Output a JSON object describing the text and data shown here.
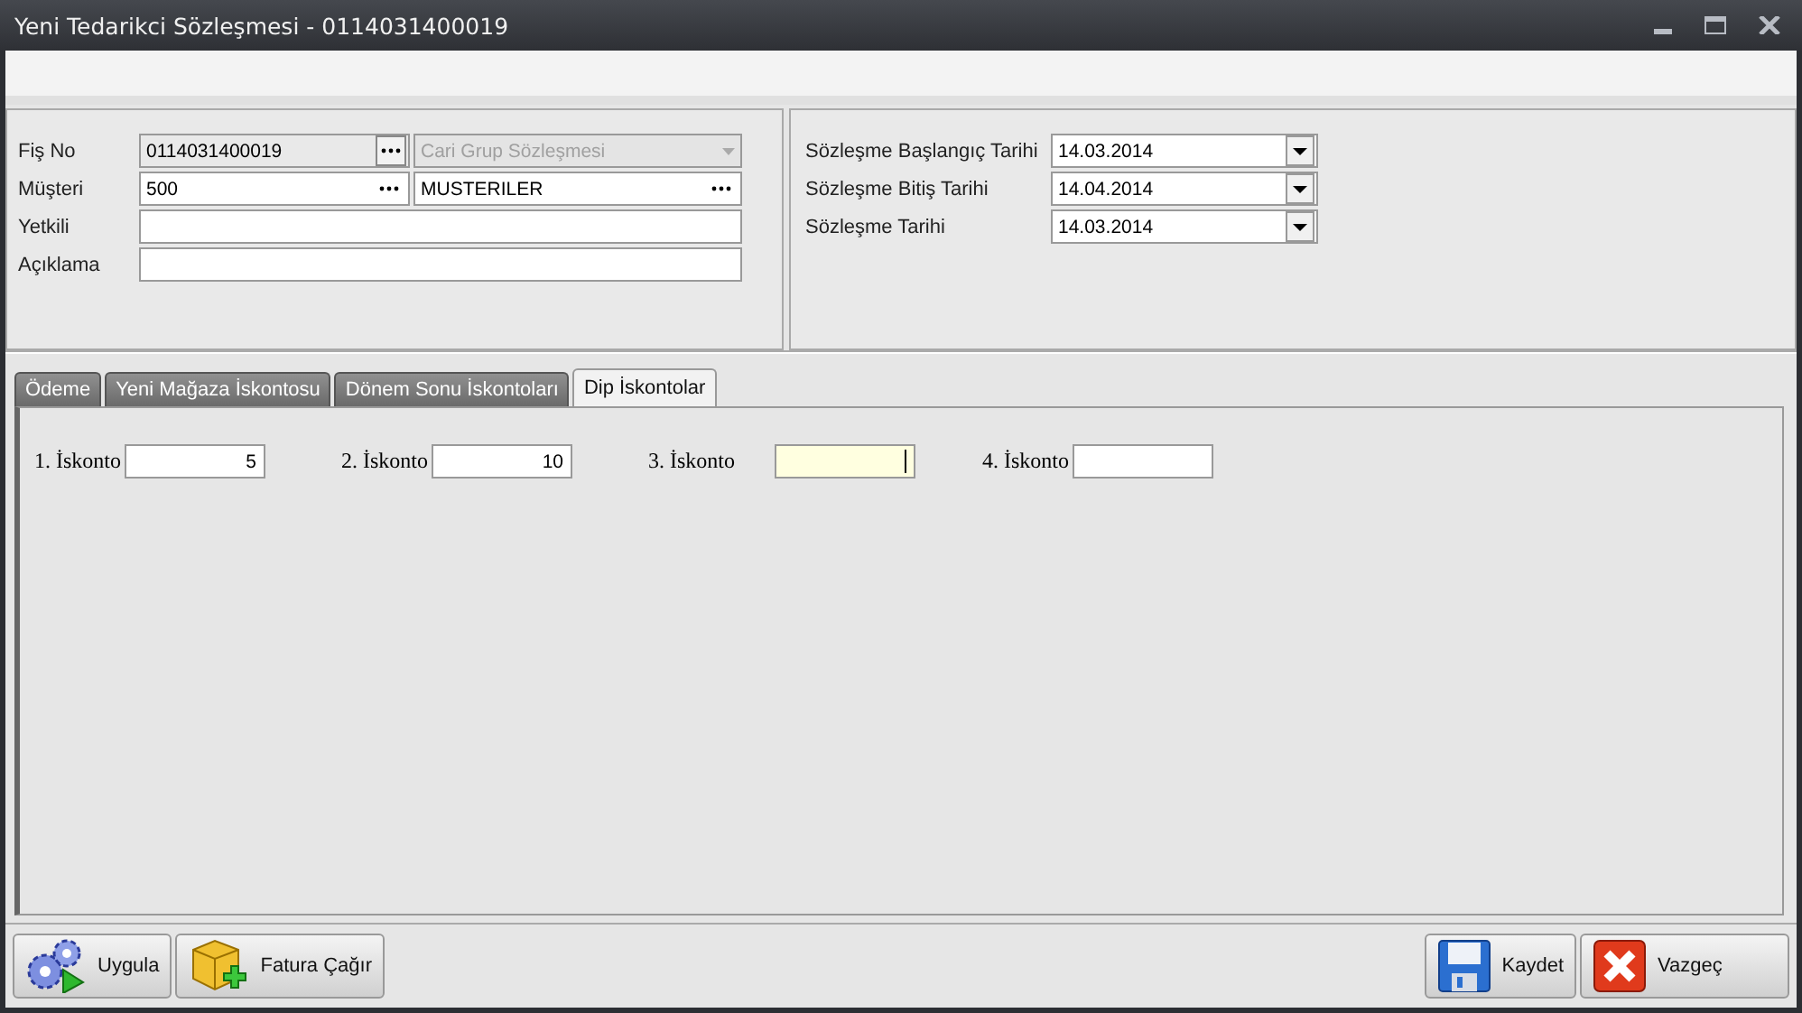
{
  "window": {
    "title": "Yeni Tedarikci Sözleşmesi - 0114031400019"
  },
  "header": {
    "rows": [
      {
        "label": "Fiş No",
        "value": "0114031400019",
        "kind": "code"
      },
      {
        "label": "Müşteri",
        "value": "500",
        "kind": "customer"
      },
      {
        "label": "Yetkili",
        "kind": "text"
      },
      {
        "label": "Açıklama",
        "kind": "text"
      }
    ],
    "group": {
      "value": "Cari Grup Sözleşmesi",
      "disabled": true
    },
    "customer_group": {
      "value": "MUSTERILER"
    },
    "dates": [
      {
        "label": "Sözleşme Başlangıç Tarihi",
        "value": "14.03.2014"
      },
      {
        "label": "Sözleşme Bitiş Tarihi",
        "value": "14.04.2014"
      },
      {
        "label": "Sözleşme Tarihi",
        "value": "14.03.2014"
      }
    ]
  },
  "tabs": [
    {
      "label": "Ödeme",
      "selected": false
    },
    {
      "label": "Yeni Mağaza İskontosu",
      "selected": false
    },
    {
      "label": "Dönem Sonu İskontoları",
      "selected": false
    },
    {
      "label": "Dip İskontolar",
      "selected": true
    }
  ],
  "discounts": [
    {
      "label": "1. İskonto",
      "value": "5",
      "focused": false
    },
    {
      "label": "2. İskonto",
      "value": "10",
      "focused": false
    },
    {
      "label": "3. İskonto",
      "focused": true
    },
    {
      "label": "4. İskonto",
      "focused": false
    }
  ],
  "buttons_left": [
    {
      "label": "Uygula",
      "kind": "apply"
    },
    {
      "label": "Fatura Çağır",
      "kind": "invoice"
    }
  ],
  "buttons_right": [
    {
      "label": "Kaydet",
      "kind": "save"
    },
    {
      "label": "Vazgeç",
      "kind": "cancel"
    }
  ]
}
